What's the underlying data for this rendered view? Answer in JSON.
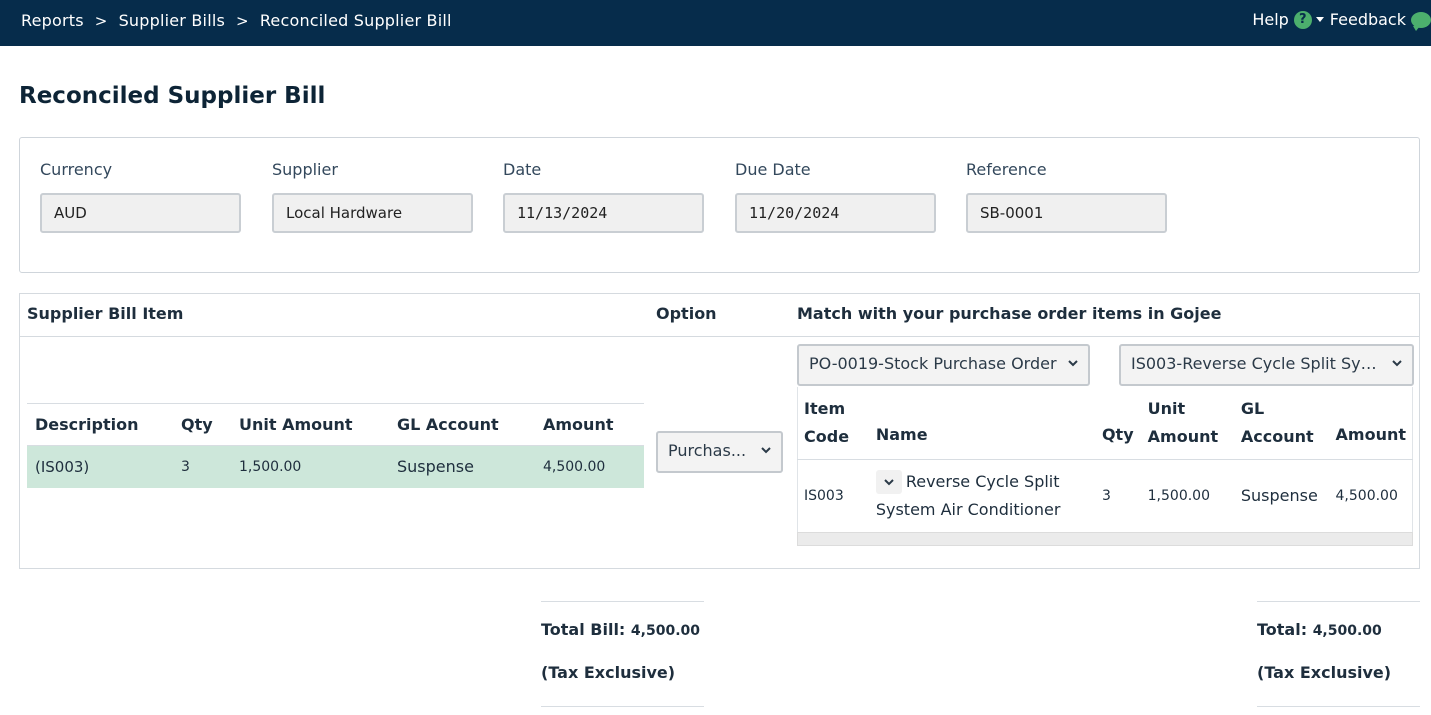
{
  "breadcrumb": {
    "items": [
      "Reports",
      "Supplier Bills",
      "Reconciled Supplier Bill"
    ],
    "separator": ">"
  },
  "header_actions": {
    "help_label": "Help",
    "help_icon": "?",
    "feedback_label": "Feedback"
  },
  "page_title": "Reconciled Supplier Bill",
  "form": {
    "currency": {
      "label": "Currency",
      "value": "AUD"
    },
    "supplier": {
      "label": "Supplier",
      "value": "Local Hardware"
    },
    "date": {
      "label": "Date",
      "value": "11/13/2024"
    },
    "due_date": {
      "label": "Due Date",
      "value": "11/20/2024"
    },
    "reference": {
      "label": "Reference",
      "value": "SB-0001"
    }
  },
  "items": {
    "col_supplier_bill_item": "Supplier Bill Item",
    "col_option": "Option",
    "col_match": "Match with your purchase order items in Gojee",
    "bill_table": {
      "headers": [
        "Description",
        "Qty",
        "Unit Amount",
        "GL Account",
        "Amount"
      ],
      "rows": [
        [
          "(IS003)",
          "3",
          "1,500.00",
          "Suspense",
          "4,500.00"
        ]
      ]
    },
    "option_select": "Purchas...",
    "po_select": "PO-0019-Stock Purchase Order",
    "item_select": "IS003-Reverse Cycle Split Sys...",
    "po_table": {
      "headers": {
        "item_code_1": "Item",
        "item_code_2": "Code",
        "name": "Name",
        "qty": "Qty",
        "unit_amount_1": "Unit",
        "unit_amount_2": "Amount",
        "gl_account_1": "GL",
        "gl_account_2": "Account",
        "amount": "Amount"
      },
      "rows": [
        {
          "item_code": "IS003",
          "name_1": "Reverse Cycle Split",
          "name_2": "System Air Conditioner",
          "qty": "3",
          "unit_amount": "1,500.00",
          "gl_account": "Suspense",
          "amount": "4,500.00"
        }
      ]
    }
  },
  "totals": {
    "bill_label": "Total Bill:",
    "bill_value": "4,500.00",
    "bill_note": "(Tax Exclusive)",
    "po_label": "Total:",
    "po_value": "4,500.00",
    "po_note": "(Tax Exclusive)"
  },
  "colors": {
    "topbar": "#062c4b",
    "accent_green": "#4caf6d",
    "row_highlight": "#cde7da"
  }
}
